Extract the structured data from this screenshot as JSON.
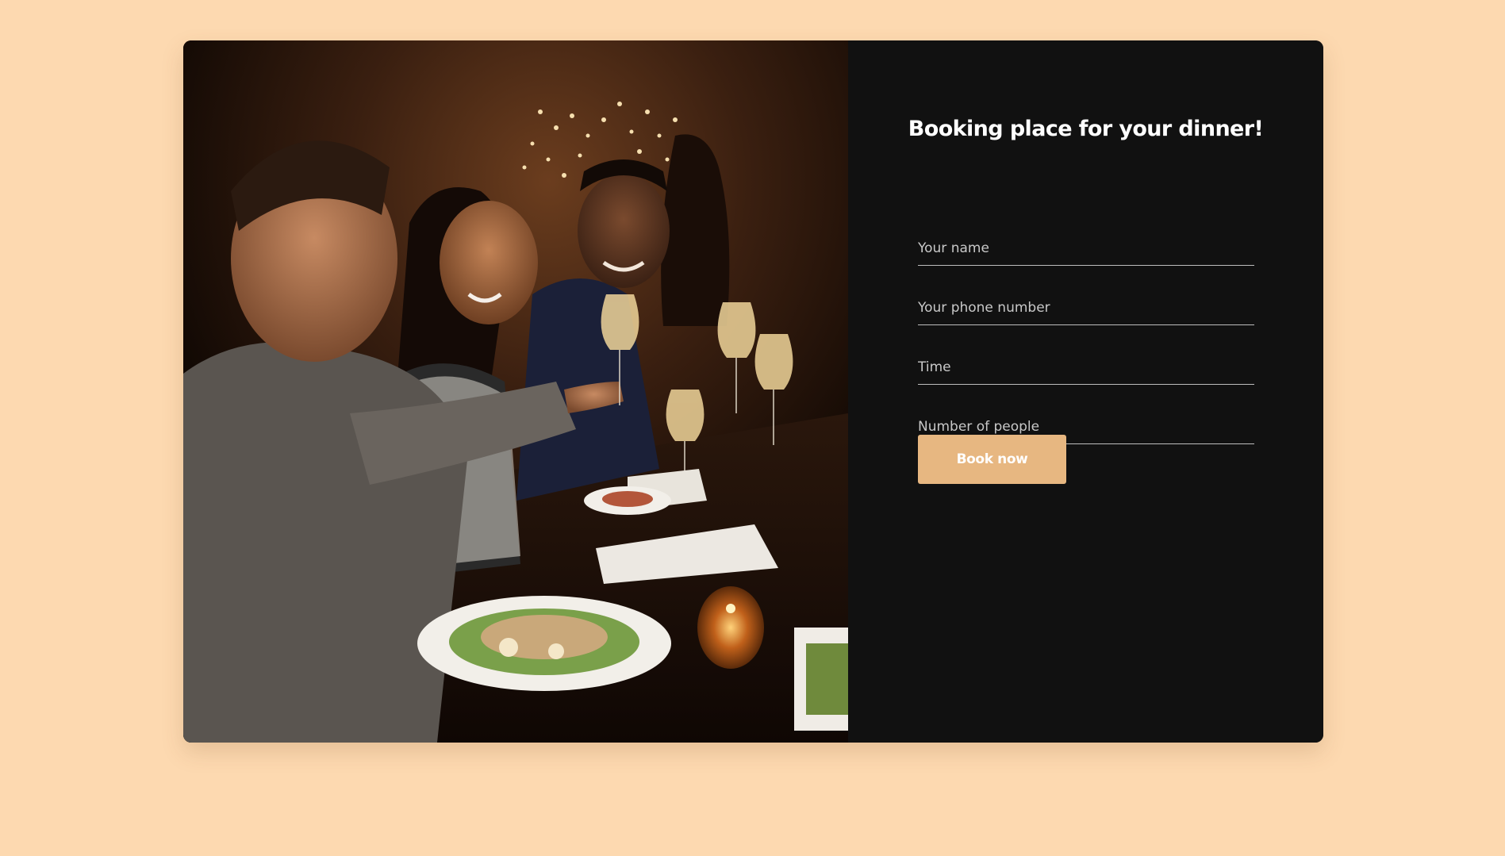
{
  "form": {
    "title": "Booking place for your dinner!",
    "name_placeholder": "Your name",
    "phone_placeholder": "Your phone number",
    "time_placeholder": "Time",
    "people_placeholder": "Number of people",
    "submit_label": "Book now"
  },
  "image": {
    "icon": "restaurant-dinner-photo"
  },
  "colors": {
    "page_background": "#fdd9b0",
    "panel_background": "#111111",
    "accent": "#e7b781",
    "text": "#ffffff"
  }
}
